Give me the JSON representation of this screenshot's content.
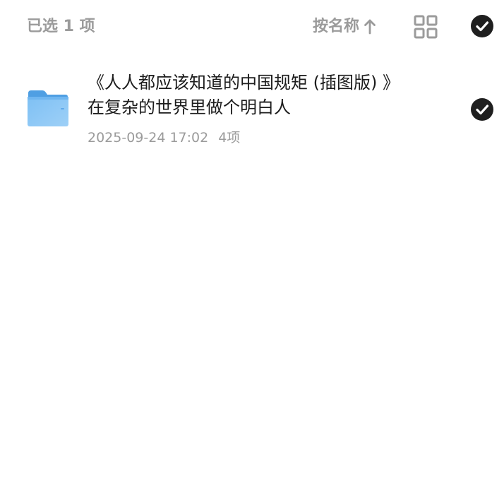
{
  "header": {
    "selected_label": "已选 1 项",
    "sort_label": "按名称",
    "sort_direction_icon": "arrow-up-icon",
    "view_toggle_icon": "grid-view-icon",
    "select_all_icon": "check-circle-icon",
    "select_all_checked": true
  },
  "files": [
    {
      "type": "folder",
      "icon": "folder-icon",
      "title_line1": "《人人都应该知道的中国规矩 (插图版) 》",
      "title_line2": "在复杂的世界里做个明白人",
      "date": "2025-09-24 17:02",
      "count": "4项",
      "checked": true
    }
  ],
  "colors": {
    "muted_text": "#9b9b9b",
    "primary_text": "#1c1c1c",
    "check_fill": "#1f1f1f",
    "folder_blue": "#6fb6f0",
    "folder_blue_dark": "#4f9fe3"
  }
}
